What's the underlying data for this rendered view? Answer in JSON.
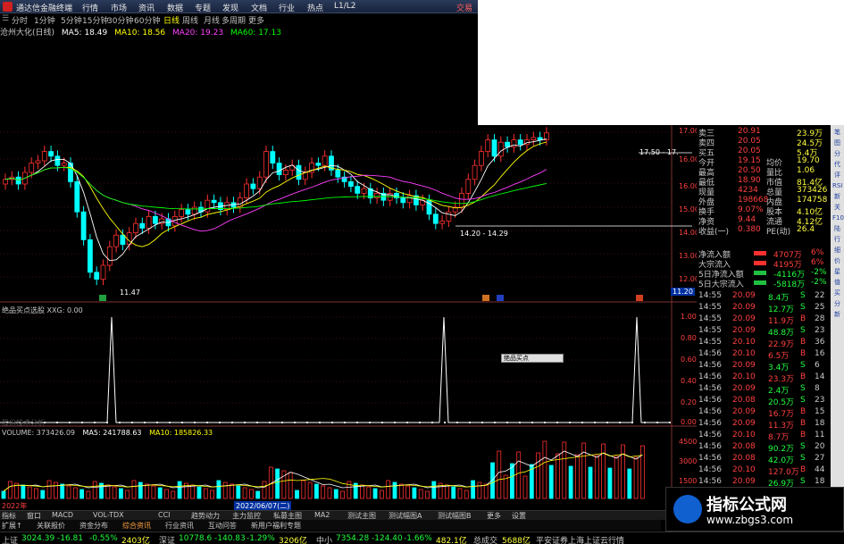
{
  "titlebar": {
    "title": "通达信金融终端",
    "menu": [
      "行情",
      "市场",
      "资讯",
      "数据",
      "专题",
      "发现",
      "文档",
      "行业",
      "热点",
      "L1/L2"
    ],
    "trade": "交易"
  },
  "periods": [
    "分时",
    "1分钟",
    "5分钟",
    "15分钟",
    "30分钟",
    "60分钟",
    "日线",
    "周线",
    "月线",
    "多周期",
    "更多"
  ],
  "period_active": "日线",
  "ma_legend": {
    "stock": "沧州大化(日线)",
    "ma5": "MA5: 18.49",
    "ma10": "MA10: 18.56",
    "ma20": "MA20: 19.23",
    "ma60": "MA60: 17.13"
  },
  "colors": {
    "ma5": "#ffffff",
    "ma10": "#ffff00",
    "ma20": "#ff40ff",
    "ma60": "#00ff00",
    "up": "#ff3030",
    "down": "#00ffff"
  },
  "price_axis": [
    "16.00",
    "15.00",
    "14.00",
    "13.00",
    "12.00"
  ],
  "price_axis_top": [
    "17.00",
    "16.00"
  ],
  "price_labels": {
    "low": "11.47",
    "range1": "14.20 - 14.29",
    "range2": "17.50 - 17.",
    "last": "11.20"
  },
  "signal_title": "绝品买点选股 XXG: 0.00",
  "signal_axis": [
    "1.00",
    "0.80",
    "0.60",
    "0.40",
    "0.20",
    "0.00"
  ],
  "signal_sublabel": "股份技术分析",
  "volume_title": {
    "vol": "VOLUME: 373426.09",
    "ma5": "MA5: 241788.63",
    "ma10": "MA10: 185826.33"
  },
  "volume_axis": [
    "45000",
    "30000",
    "15000"
  ],
  "date_label": "2022/06/07(二)",
  "date_label2": "2022年",
  "tooltip": "绝品买点",
  "quote_rows": [
    {
      "k": "卖三",
      "v": "20.91",
      "v2": "23.9万"
    },
    {
      "k": "卖四",
      "v": "20.05",
      "v2": "24.5万"
    },
    {
      "k": "买五",
      "v": "20.05",
      "v2": "5.4万"
    },
    {
      "k": "今开",
      "v": "19.15",
      "k2": "均价",
      "v2": "19.70"
    },
    {
      "k": "最高",
      "v": "20.50",
      "k2": "量比",
      "v2": "1.06"
    },
    {
      "k": "最低",
      "v": "18.90",
      "k2": "市值",
      "v2": "81.4亿"
    },
    {
      "k": "现量",
      "v": "4234",
      "k2": "总量",
      "v2": "373426"
    },
    {
      "k": "外盘",
      "v": "198668",
      "k2": "内盘",
      "v2": "174758"
    },
    {
      "k": "换手",
      "v": "9.07%",
      "k2": "股本",
      "v2": "4.10亿"
    },
    {
      "k": "净资",
      "v": "9.44",
      "k2": "流通",
      "v2": "4.12亿"
    },
    {
      "k": "收益(一)",
      "v": "0.380",
      "k2": "PE(动)",
      "v2": "26.4"
    }
  ],
  "flow_rows": [
    {
      "k": "净流入额",
      "v": "4707万",
      "p": "6%"
    },
    {
      "k": "大宗流入",
      "v": "4195万",
      "p": "6%"
    },
    {
      "k": "5日净流入额",
      "v": "-4116万",
      "p": "-2%"
    },
    {
      "k": "5日大宗流入",
      "v": "-5818万",
      "p": "-2%"
    }
  ],
  "ticks": [
    {
      "t": "14:55",
      "p": "20.09",
      "v": "8.4万",
      "d": "S",
      "n": "22"
    },
    {
      "t": "14:55",
      "p": "20.09",
      "v": "12.7万",
      "d": "S",
      "n": "25"
    },
    {
      "t": "14:55",
      "p": "20.09",
      "v": "11.9万",
      "d": "B",
      "n": "28"
    },
    {
      "t": "14:55",
      "p": "20.09",
      "v": "48.8万",
      "d": "S",
      "n": "23"
    },
    {
      "t": "14:55",
      "p": "20.10",
      "v": "22.9万",
      "d": "B",
      "n": "36"
    },
    {
      "t": "14:56",
      "p": "20.10",
      "v": "6.5万",
      "d": "B",
      "n": "16"
    },
    {
      "t": "14:56",
      "p": "20.09",
      "v": "3.4万",
      "d": "S",
      "n": "6"
    },
    {
      "t": "14:56",
      "p": "20.10",
      "v": "23.3万",
      "d": "B",
      "n": "14"
    },
    {
      "t": "14:56",
      "p": "20.09",
      "v": "2.4万",
      "d": "S",
      "n": "8"
    },
    {
      "t": "14:56",
      "p": "20.08",
      "v": "20.5万",
      "d": "S",
      "n": "23"
    },
    {
      "t": "14:56",
      "p": "20.09",
      "v": "16.7万",
      "d": "B",
      "n": "15"
    },
    {
      "t": "14:56",
      "p": "20.09",
      "v": "11.3万",
      "d": "B",
      "n": "18"
    },
    {
      "t": "14:56",
      "p": "20.10",
      "v": "8.7万",
      "d": "B",
      "n": "11"
    },
    {
      "t": "14:56",
      "p": "20.08",
      "v": "90.2万",
      "d": "S",
      "n": "20"
    },
    {
      "t": "14:56",
      "p": "20.08",
      "v": "42.0万",
      "d": "S",
      "n": "27"
    },
    {
      "t": "14:56",
      "p": "20.10",
      "v": "127.0万",
      "d": "B",
      "n": "44"
    },
    {
      "t": "14:56",
      "p": "20.09",
      "v": "26.9万",
      "d": "S",
      "n": "18"
    },
    {
      "t": "14:56",
      "p": "20.08",
      "v": "17.9万",
      "d": "S",
      "n": "19"
    },
    {
      "t": "14:56",
      "p": "20.08",
      "v": "3.7万",
      "d": "S",
      "n": "6"
    }
  ],
  "sidebar": [
    "笔",
    "图",
    "分",
    "代",
    "评",
    "RSI",
    "新",
    "关",
    "F10",
    "陆",
    "行",
    "细",
    "价",
    "星",
    "值",
    "买",
    "分",
    "新"
  ],
  "bottom_tabs": [
    "指标",
    "窗口",
    "MACD",
    "VOL-TDX",
    "CCI",
    "趋势动力",
    "主力监控",
    "私募主图",
    "MA2",
    "测试主图",
    "测试幅图A",
    "测试幅图B",
    "更多",
    "设置"
  ],
  "bottom_tabs2": [
    "扩展↑",
    "关联报价",
    "资金分布",
    "综合资讯",
    "行业资讯",
    "互动问答",
    "新用户福利专题"
  ],
  "status": [
    {
      "k": "上证",
      "v": "3024.39",
      "c": "-16.81",
      "pc": "-0.55%",
      "a": "2403亿"
    },
    {
      "k": "深证",
      "v": "10778.6",
      "c": "-140.83",
      "pc": "-1.29%",
      "a": "3206亿"
    },
    {
      "k": "中小",
      "v": "7354.28",
      "c": "-124.40",
      "pc": "-1.66%",
      "a": "482.1亿"
    }
  ],
  "status_total": {
    "k": "总成交",
    "v": "5688亿"
  },
  "status_broker": "平安证券上海上证云行情",
  "watermark": {
    "title": "指标公式网",
    "url": "www.zbgs3.com"
  }
}
